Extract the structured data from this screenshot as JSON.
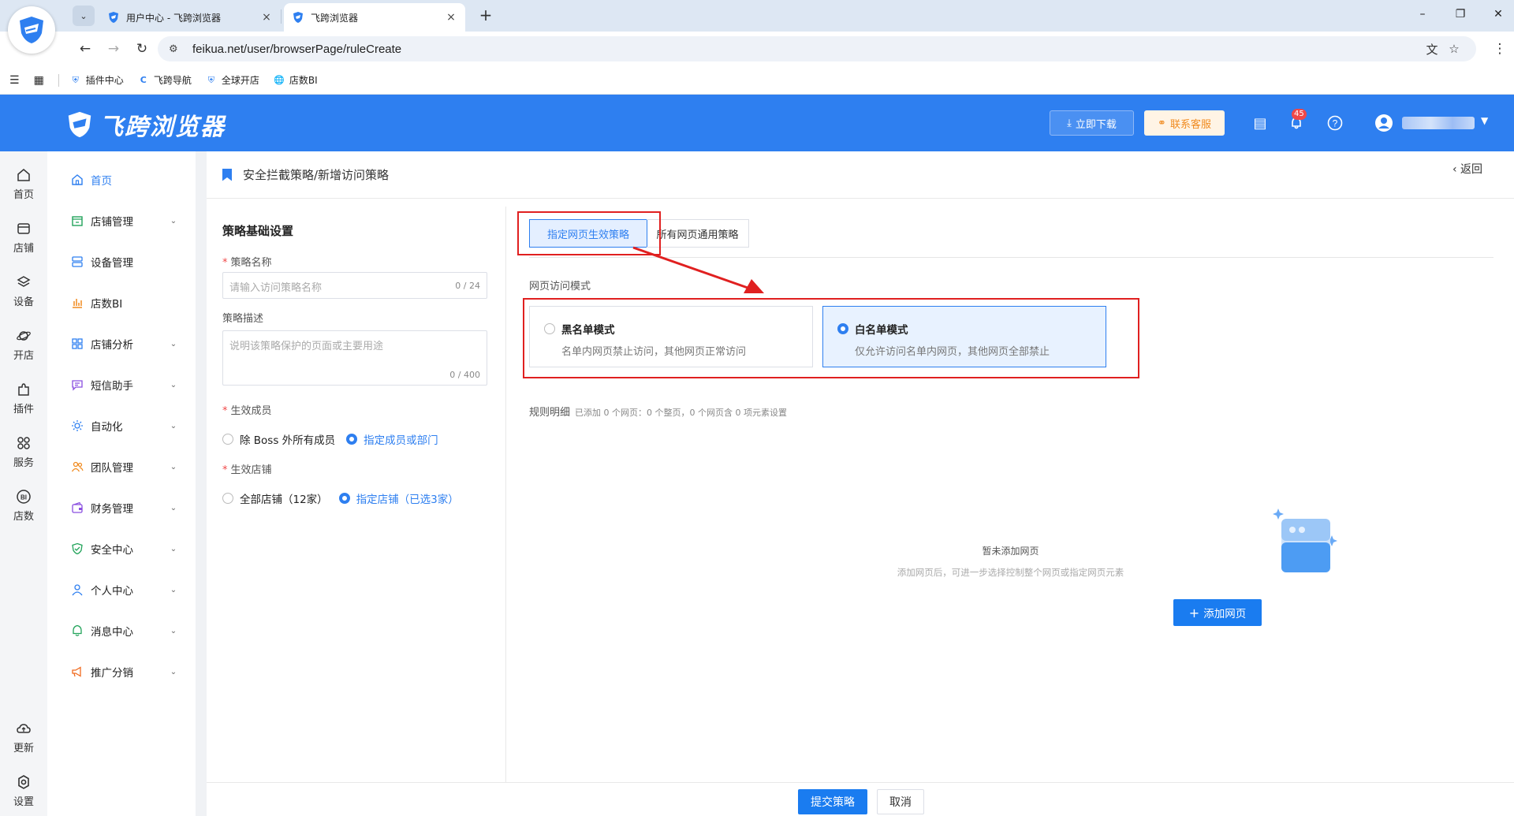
{
  "browser": {
    "tabs": [
      {
        "title": "用户中心 - 飞跨浏览器",
        "active": false
      },
      {
        "title": "飞跨浏览器",
        "active": true
      }
    ],
    "url": "feikua.net/user/browserPage/ruleCreate",
    "bookmarks": [
      "插件中心",
      "飞跨导航",
      "全球开店",
      "店数BI"
    ]
  },
  "header": {
    "brand": "飞跨浏览器",
    "download_label": "立即下载",
    "service_label": "联系客服",
    "notification_count": "45"
  },
  "rail": {
    "items": [
      "首页",
      "店铺",
      "设备",
      "开店",
      "插件",
      "服务",
      "店数"
    ],
    "bottom": [
      "更新",
      "设置"
    ]
  },
  "sidebar": {
    "items": [
      {
        "label": "首页",
        "active": true
      },
      {
        "label": "店铺管理"
      },
      {
        "label": "设备管理"
      },
      {
        "label": "店数BI"
      },
      {
        "label": "店铺分析"
      },
      {
        "label": "短信助手"
      },
      {
        "label": "自动化"
      },
      {
        "label": "团队管理"
      },
      {
        "label": "财务管理"
      },
      {
        "label": "安全中心"
      },
      {
        "label": "个人中心"
      },
      {
        "label": "消息中心"
      },
      {
        "label": "推广分销"
      }
    ]
  },
  "page": {
    "breadcrumb": "安全拦截策略/新增访问策略",
    "back_label": "返回"
  },
  "form": {
    "section_title": "策略基础设置",
    "name_label": "策略名称",
    "name_placeholder": "请输入访问策略名称",
    "name_count": "0 / 24",
    "desc_label": "策略描述",
    "desc_placeholder": "说明该策略保护的页面或主要用途",
    "desc_count": "0 / 400",
    "members_label": "生效成员",
    "members_opt1": "除 Boss 外所有成员",
    "members_opt2": "指定成员或部门",
    "shops_label": "生效店铺",
    "shops_opt1": "全部店铺（12家）",
    "shops_opt2": "指定店铺（已选3家）"
  },
  "policy": {
    "tab_specific": "指定网页生效策略",
    "tab_all": "所有网页通用策略",
    "mode_label": "网页访问模式",
    "blacklist_title": "黑名单模式",
    "blacklist_desc": "名单内网页禁止访问，其他网页正常访问",
    "whitelist_title": "白名单模式",
    "whitelist_desc": "仅允许访问名单内网页，其他网页全部禁止",
    "selected_mode": "whitelist",
    "rules_label": "规则明细",
    "rules_summary": "已添加 0 个网页：0 个整页，0 个网页含 0 项元素设置",
    "empty_title": "暂未添加网页",
    "empty_sub": "添加网页后，可进一步选择控制整个网页或指定网页元素",
    "add_label": "添加网页"
  },
  "footer": {
    "submit_label": "提交策略",
    "cancel_label": "取消"
  },
  "colors": {
    "primary": "#2e7ff0",
    "annotation": "#e02020",
    "service": "#f08a1e"
  }
}
